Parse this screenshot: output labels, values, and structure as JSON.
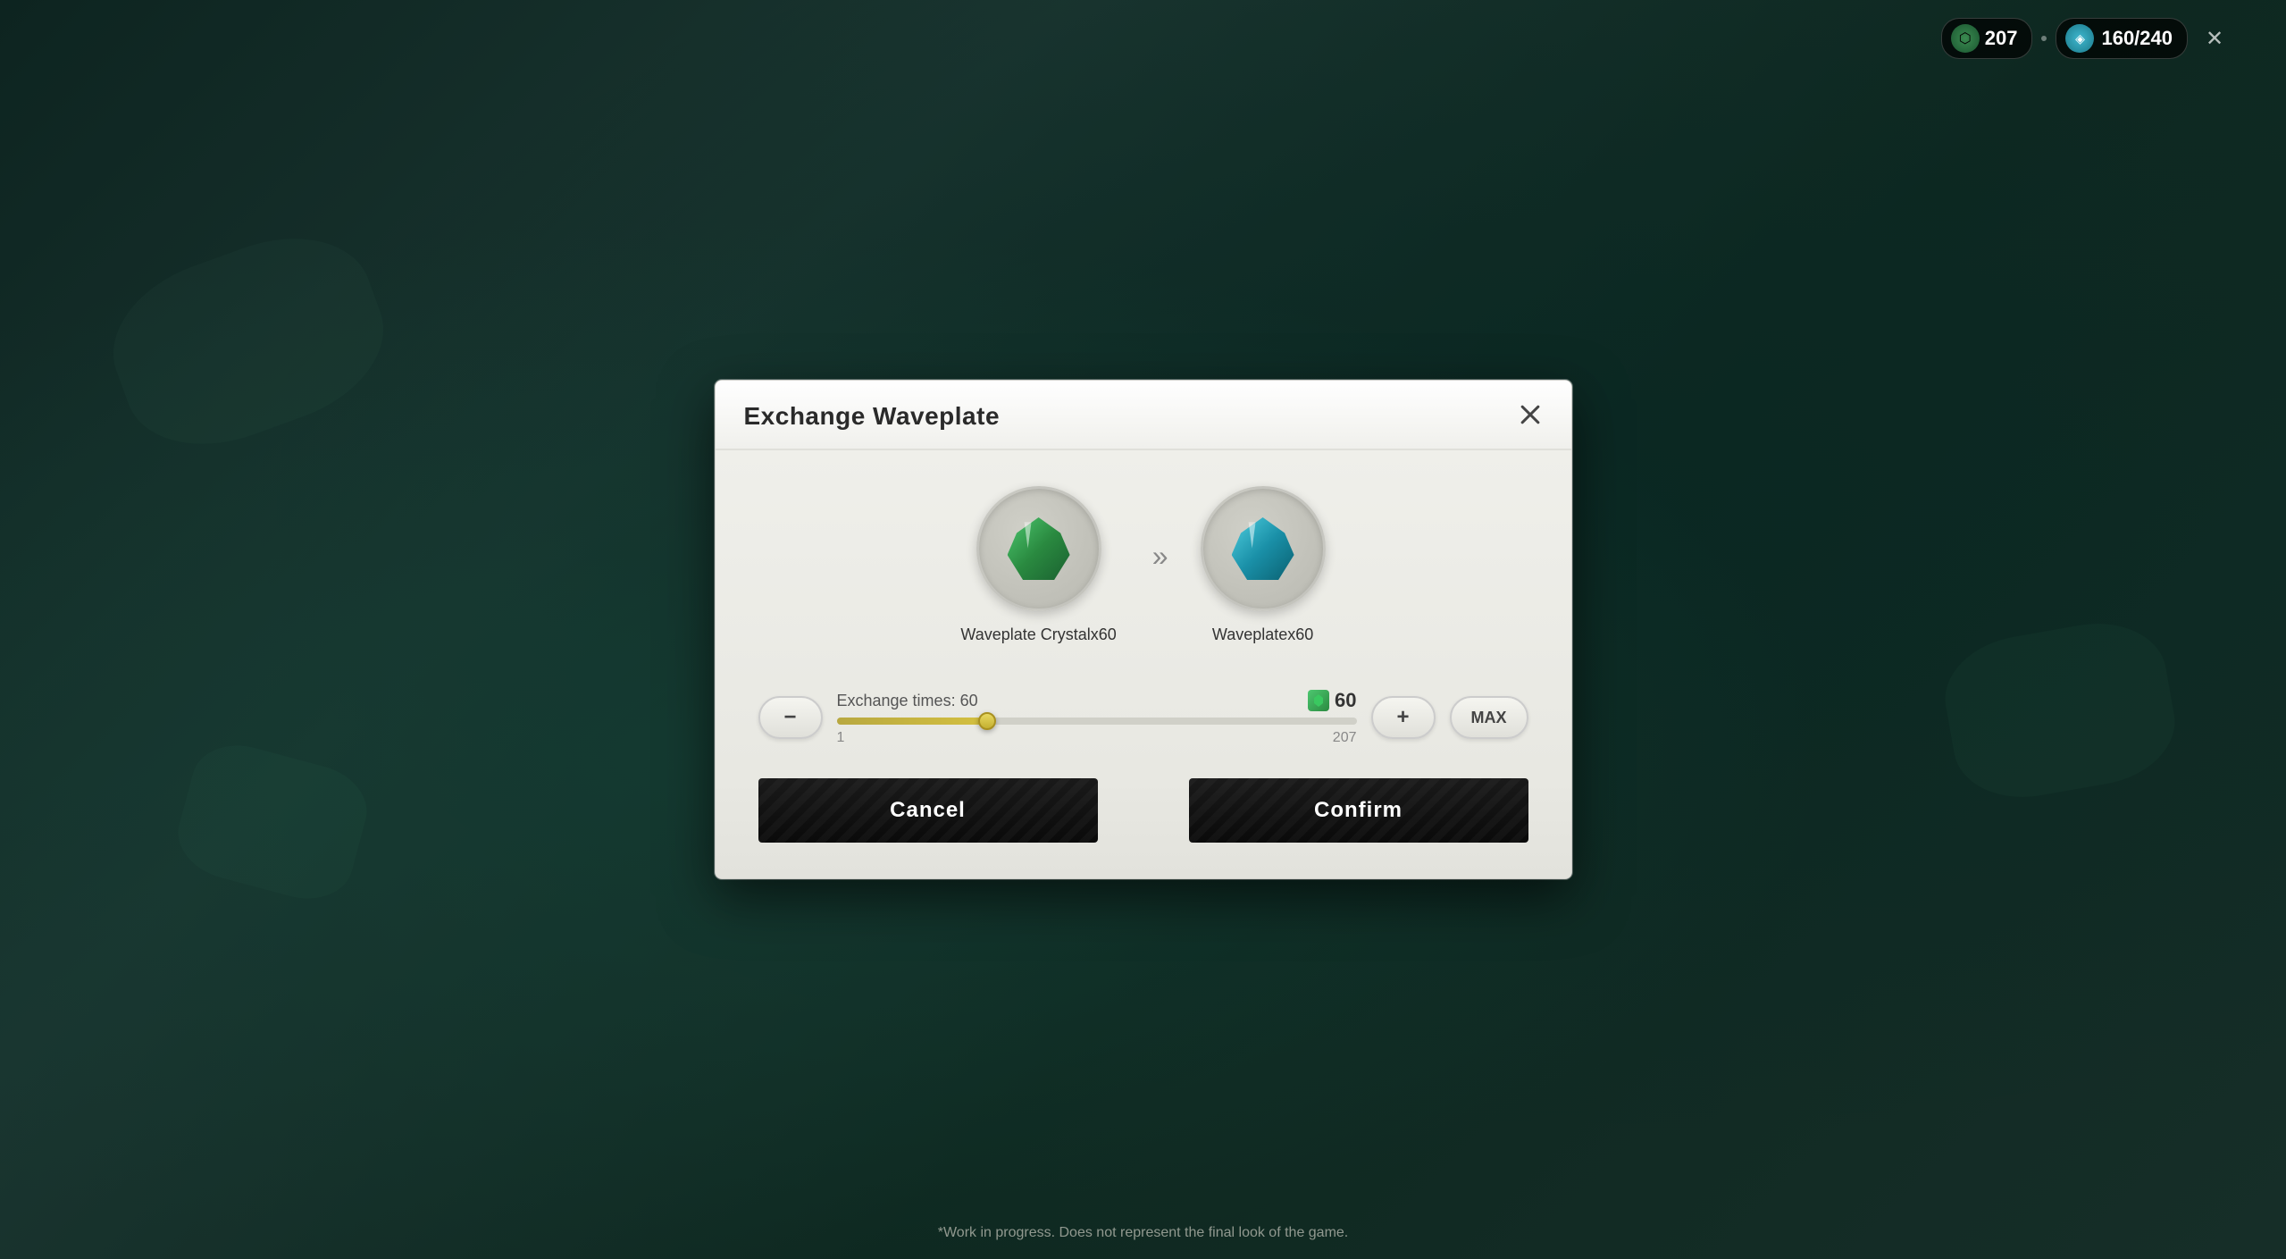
{
  "app": {
    "title": "Exchange Waveplate",
    "disclaimer": "*Work in progress. Does not represent the final look of the game."
  },
  "hud": {
    "resource1": {
      "value": "207",
      "icon": "⬡"
    },
    "separator": "•",
    "waveplate": {
      "value": "160/240",
      "icon": "◈"
    }
  },
  "dialog": {
    "title": "Exchange Waveplate",
    "close_label": "×",
    "from_item": {
      "label": "Waveplate Crystalx60"
    },
    "to_item": {
      "label": "Waveplatex60"
    },
    "exchange": {
      "label": "Exchange times: 60",
      "count": "60",
      "min": "1",
      "max": "207",
      "slider_percent": 29
    },
    "minus_label": "−",
    "plus_label": "+",
    "max_label": "MAX",
    "cancel_label": "Cancel",
    "confirm_label": "Confirm"
  }
}
